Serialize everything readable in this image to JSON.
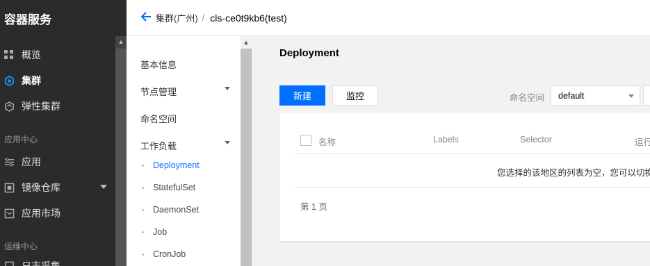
{
  "app": {
    "title": "容器服务"
  },
  "leftnav": {
    "items": [
      {
        "label": "概览",
        "icon": "grid-icon"
      },
      {
        "label": "集群",
        "icon": "cluster-icon",
        "active": true
      },
      {
        "label": "弹性集群",
        "icon": "elastic-cluster-icon"
      }
    ],
    "section_app": "应用中心",
    "app_items": [
      {
        "label": "应用",
        "icon": "app-icon"
      },
      {
        "label": "镜像仓库",
        "icon": "registry-icon"
      },
      {
        "label": "应用市场",
        "icon": "market-icon"
      }
    ],
    "section_ops": "运维中心",
    "ops_items_partial": [
      {
        "label": "日志采集"
      }
    ]
  },
  "header": {
    "breadcrumb_cluster": "集群(广州)",
    "separator": "/",
    "cluster_name": "cls-ce0t9kb6(test)"
  },
  "subnav": {
    "items": [
      {
        "label": "基本信息"
      },
      {
        "label": "节点管理",
        "expandable": true
      },
      {
        "label": "命名空间"
      },
      {
        "label": "工作负载",
        "expandable": true,
        "expanded": true
      }
    ],
    "workload_children": [
      {
        "label": "Deployment",
        "active": true
      },
      {
        "label": "StatefulSet"
      },
      {
        "label": "DaemonSet"
      },
      {
        "label": "Job"
      },
      {
        "label": "CronJob"
      }
    ]
  },
  "main": {
    "title": "Deployment",
    "create_label": "新建",
    "monitor_label": "监控",
    "namespace_label": "命名空间",
    "namespace_value": "default",
    "table": {
      "columns": [
        "名称",
        "Labels",
        "Selector",
        "运行"
      ],
      "empty_text": "您选择的该地区的列表为空，您可以切换到"
    },
    "pager": "第 1 页"
  },
  "colors": {
    "accent": "#006eff",
    "sidebar_bg": "#2b2b2b",
    "page_bg": "#f2f2f2"
  }
}
